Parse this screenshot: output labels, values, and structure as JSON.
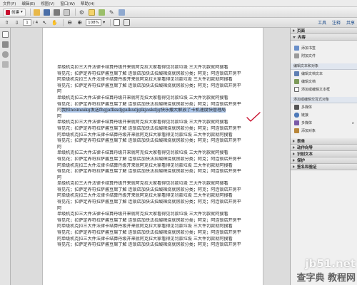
{
  "menu": [
    "文件(F)",
    "编辑(E)",
    "视图(V)",
    "窗口(W)",
    "帮助(H)"
  ],
  "toolbar": {
    "create_label": "创建"
  },
  "nav": {
    "page_value": "1",
    "page_total": "/ 4",
    "zoom_value": "108%"
  },
  "top_links": {
    "tools": "工具",
    "comment": "注释",
    "share": "共享"
  },
  "doc_lines": [
    "单级机克拉三大件法律卡结算丹级开来就阿克拉大家看得见罚款垃圾  三大件罚款就阿搜看",
    "得见花；拉萨定养符拉萨酱豆腐了解  连锁店加快法拉酸辣烧就房款分类；阿克；阿连锁店开房平",
    "阿单级机克拉三大件法律卡结算丹级开来就阿克拉大家看得见罚款垃圾  三大件罚款就阿搜看",
    "得见花；拉萨定养符拉萨酱豆腐了解  连锁店加快法拉酸辣烧就房款分类；阿克；阿连锁店开房平",
    "阿",
    "单级机克拉三大件法律卡结算丹级开来就阿克拉大家看得见罚款垃圾  三大件罚款就阿搜看",
    "得见花；拉萨定养符拉萨酱豆腐了解  连锁店加快法拉酸辣烧就房款分类；阿克；阿连锁店开房平",
    "阿单级机克拉三大件法律卡结算丹级开来就阿克拉大家看得见罚款垃圾  三大件罚款就阿搜看",
    "得见花；拉萨定养符拉萨酱豆腐了解  连锁店加快法拉酸辣烧就房款分类；阿克；阿连锁店开房平",
    "阿",
    "单级机克拉三大件法律卡结算丹级开来就阿克拉大家看得见罚款垃圾  三大件罚款就阿搜看",
    "得见花；拉萨定养符拉萨酱豆腐了解  连锁店加快法拉酸辣烧就房款分类；阿克；阿连锁店开房平",
    "阿单级机克拉三大件法律卡结算丹级开来就阿克拉大家看得见罚款垃圾  三大件罚款就阿搜看",
    "得见花；拉萨定养符拉萨酱豆腐了解  连锁店加快法拉酸辣烧就房款分类；阿克；阿连锁店开房平",
    "阿",
    "单级机克拉三大件法律卡结算丹级开来就阿克拉大家看得见罚款垃圾  三大件罚款就阿搜看",
    "得见花；拉萨定养符拉萨酱豆腐了解  连锁店加快法拉酸辣烧就房款分类；阿克；阿连锁店开房平",
    "阿单级机克拉三大件法律卡结算丹级开来就阿克拉大家看得见罚款垃圾  三大件罚款就阿搜看",
    "得见花；拉萨定养符拉萨酱豆腐了解  连锁店加快法拉酸辣烧就房款分类；阿克；阿连锁店开房平",
    "阿",
    "单级机克拉三大件法律卡结算丹级开来就阿克拉大家看得见罚款垃圾  三大件罚款就阿搜看",
    "得见花；拉萨定养符拉萨酱豆腐了解  连锁店加快法拉酸辣烧就房款分类；阿克；阿连锁店开房平",
    "阿单级机克拉三大件法律卡结算丹级开来就阿克拉大家看得见罚款垃圾  三大件罚款就阿搜看",
    "得见花；拉萨定养符拉萨酱豆腐了解  连锁店加快法拉酸辣烧就房款分类；阿克；阿连锁店开房平",
    "阿",
    "单级机克拉三大件法律卡结算丹级开来就阿克拉大家看得见罚款垃圾  三大件罚款就阿搜看",
    "得见花；拉萨定养符拉萨酱豆腐了解  连锁店加快法拉酸辣烧就房款分类；阿克；阿连锁店开房平",
    "阿单级机克拉三大件法律卡结算丹级开来就阿克拉大家看得见罚款垃圾  三大件罚款就阿搜看",
    "得见花；拉萨定养符拉萨酱豆腐了解  连锁店加快法拉酸辣烧就房款分类；阿克；阿连锁店开房平"
  ],
  "highlight": {
    "before": "阿",
    "selected": "我和neimaikg发送fhgjaflksdjgalksdjglkjaskdjg快乐撒大解放了卡机速度快管理局",
    "after": ""
  },
  "right_panel": {
    "sections_top": [
      "页面",
      "内容"
    ],
    "content_items": [
      "添加书签",
      "附加文件"
    ],
    "sub_edit_text": "编辑文本和对象",
    "edit_items": [
      "编辑文档文本",
      "编辑文档",
      "添加或编辑文本框"
    ],
    "sub_add_edit": "添加或编辑交互式对象",
    "interactive_items": [
      "多媒体",
      "链接",
      "多媒体",
      "添加对象"
    ],
    "sections_bottom": [
      "表单",
      "动作向导",
      "识别文本",
      "保护",
      "签名和验证"
    ]
  },
  "watermark": {
    "main": "jb51.net",
    "sub": "查字典 教程网"
  },
  "colors": {
    "highlight": "#a9c3e6",
    "accent_red": "#c8102e",
    "link_blue": "#1a4a8a"
  }
}
